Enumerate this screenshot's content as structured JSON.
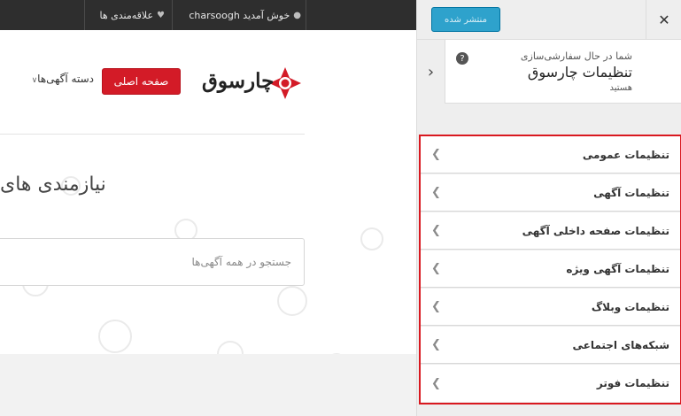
{
  "admin_bar": {
    "welcome": "خوش آمدید charsoogh",
    "wishlist": "علاقه‌مندی ها"
  },
  "site": {
    "logo_text": "چارسوق",
    "home_button": "صفحه اصلی",
    "nav_categories": "دسته آگهی‌ها",
    "hero_title": "نیازمندی های",
    "search_placeholder": "جستجو در همه آگهی‌ها"
  },
  "customizer": {
    "publish_label": "منتشر شده",
    "info_sub": "شما در حال سفارشی‌سازی",
    "info_title": "تنظیمات چارسوق",
    "info_trail": "هستید",
    "help_label": "?",
    "sections": [
      {
        "label": "تنظیمات عمومی"
      },
      {
        "label": "تنظیمات آگهی"
      },
      {
        "label": "تنظیمات صفحه داخلی آگهی"
      },
      {
        "label": "تنظیمات آگهی ویژه"
      },
      {
        "label": "تنظیمات وبلاگ"
      },
      {
        "label": "شبکه‌های اجتماعی"
      },
      {
        "label": "تنظیمات فوتر"
      }
    ]
  },
  "colors": {
    "brand_red": "#d31b27",
    "publish_blue": "#2ea2cc",
    "admin_bar": "#2e2e2e",
    "highlight_border": "#d9181f"
  },
  "icons": [
    "user-icon",
    "heart-icon",
    "close-icon",
    "chevron-right-icon",
    "help-icon",
    "chevron-left-icon",
    "logo-diamond-icon"
  ]
}
